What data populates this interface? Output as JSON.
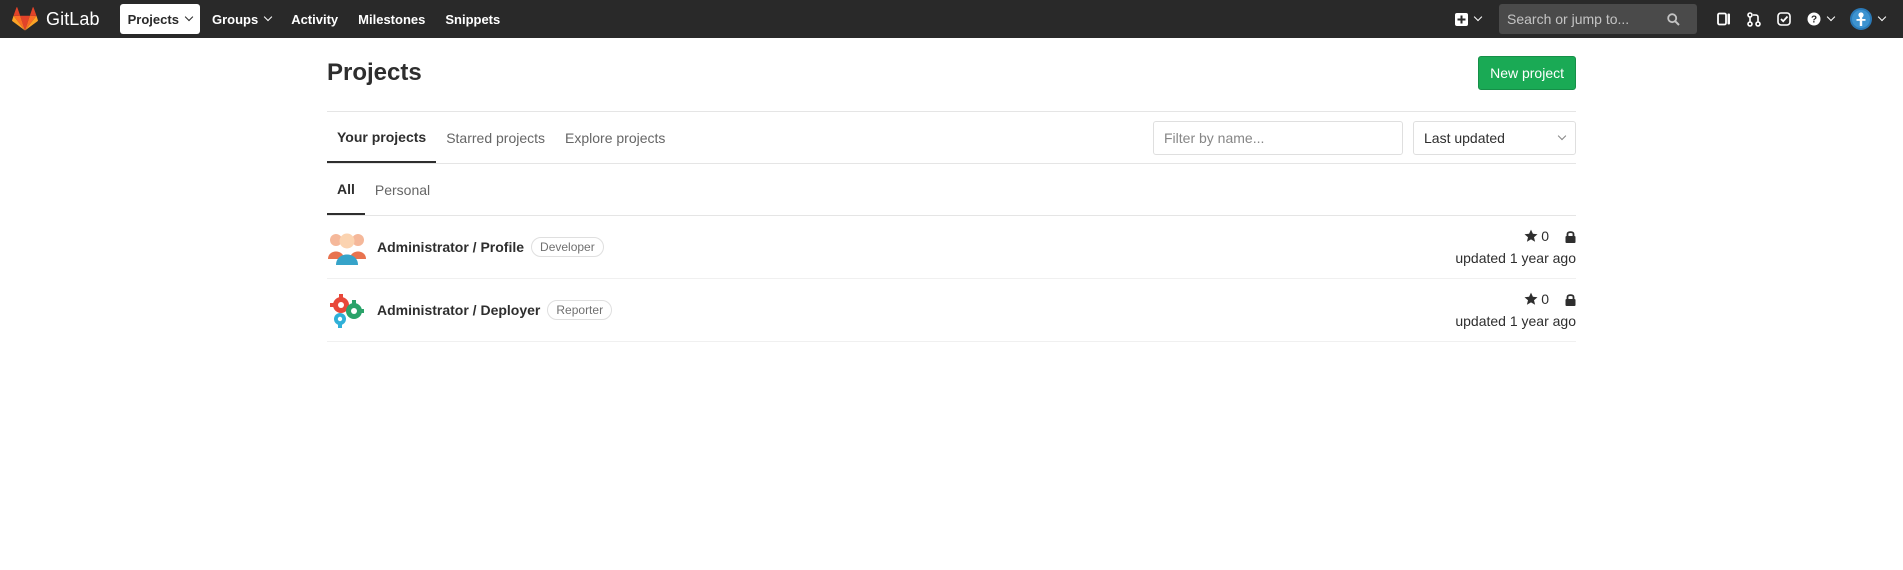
{
  "navbar": {
    "brand": "GitLab",
    "links": [
      {
        "label": "Projects",
        "active": true,
        "dropdown": true
      },
      {
        "label": "Groups",
        "active": false,
        "dropdown": true
      },
      {
        "label": "Activity",
        "active": false,
        "dropdown": false
      },
      {
        "label": "Milestones",
        "active": false,
        "dropdown": false
      },
      {
        "label": "Snippets",
        "active": false,
        "dropdown": false
      }
    ],
    "search_placeholder": "Search or jump to...",
    "icons": [
      "plus-square-icon",
      "search-icon",
      "issues-icon",
      "merge-request-icon",
      "todo-check-icon",
      "help-icon",
      "user-avatar-icon"
    ]
  },
  "page": {
    "title": "Projects",
    "new_project_label": "New project"
  },
  "tabs": [
    {
      "label": "Your projects",
      "active": true
    },
    {
      "label": "Starred projects",
      "active": false
    },
    {
      "label": "Explore projects",
      "active": false
    }
  ],
  "filter": {
    "placeholder": "Filter by name...",
    "sort_label": "Last updated"
  },
  "subtabs": [
    {
      "label": "All",
      "active": true
    },
    {
      "label": "Personal",
      "active": false
    }
  ],
  "projects": [
    {
      "name": "Administrator / Profile",
      "role": "Developer",
      "stars": "0",
      "updated": "updated 1 year ago",
      "avatar": "users-avatar"
    },
    {
      "name": "Administrator / Deployer",
      "role": "Reporter",
      "stars": "0",
      "updated": "updated 1 year ago",
      "avatar": "gears-avatar"
    }
  ],
  "colors": {
    "navbar_bg": "#292929",
    "accent_green": "#1aaa55",
    "brand_orange": "#e24329"
  }
}
